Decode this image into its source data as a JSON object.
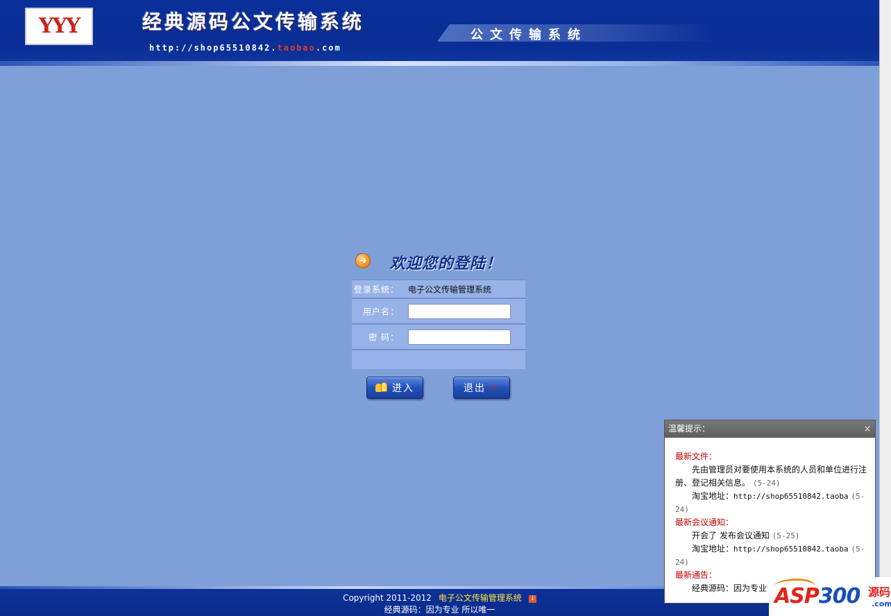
{
  "header": {
    "logo_text": "YYY",
    "title": "经典源码公文传输系统",
    "url_prefix": "http://shop65510842.",
    "url_highlight": "taobao",
    "url_suffix": ".com",
    "banner_text": "公文传输系统"
  },
  "login": {
    "welcome": "欢迎您的登陆！",
    "system_label": "登录系统：",
    "system_value": "电子公文传输管理系统",
    "username_label": "用户名：",
    "username_value": "",
    "password_label": "密  码：",
    "password_value": "",
    "enter_button": "进入",
    "exit_button": "退出"
  },
  "footer": {
    "copyright": "Copyright 2011-2012",
    "system_name": "电子公文传输管理系统",
    "slogan": "经典源码：因为专业 所以唯一"
  },
  "notice": {
    "title": "温馨提示：",
    "close": "×",
    "sections": [
      {
        "title": "最新文件：",
        "items": [
          {
            "text": "先由管理员对要使用本系统的人员和单位进行注册、登记相关信息。",
            "date": "(5-24)"
          },
          {
            "text": "淘宝地址：",
            "link": "http://shop65510842.taoba",
            "date": "(5-24)"
          }
        ]
      },
      {
        "title": "最新会议通知：",
        "items": [
          {
            "text": "开会了 发布会议通知",
            "date": "(5-25)"
          },
          {
            "text": "淘宝地址：",
            "link": "http://shop65510842.taoba",
            "date": "(5-24)"
          }
        ]
      },
      {
        "title": "最新通告：",
        "items": [
          {
            "text": "经典源码：因为专业",
            "date": ""
          }
        ]
      }
    ]
  },
  "watermark": {
    "prefix": "ASP",
    "number": "300",
    "cn": "源码",
    "com": ".com"
  },
  "colors": {
    "background": "#7f9fd9",
    "header": "#0a2e95",
    "notice_red": "#c40000"
  }
}
